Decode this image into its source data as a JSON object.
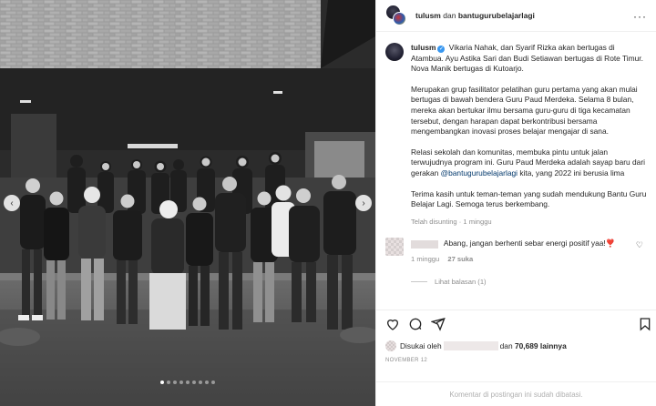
{
  "header": {
    "username": "tulusm",
    "connector": "dan",
    "collaborator": "bantugurubelajarlagi",
    "more_icon": "more-horizontal-icon"
  },
  "caption": {
    "username": "tulusm",
    "verified_icon": "verified-badge-icon",
    "paragraphs": [
      "Vikaria Nahak, dan Syarif Rizka akan bertugas di Atambua. Ayu Astika Sari dan Budi Setiawan bertugas di Rote Timur. Nova Manik bertugas di Kutoarjo.",
      "Merupakan grup fasilitator pelatihan guru pertama yang akan mulai bertugas di bawah bendera Guru Paud Merdeka. Selama 8 bulan, mereka akan bertukar ilmu bersama guru-guru di tiga kecamatan tersebut, dengan harapan dapat berkontribusi bersama mengembangkan inovasi proses belajar mengajar di sana."
    ],
    "p3_before": "Relasi sekolah dan komunitas, membuka pintu untuk jalan terwujudnya program ini. Guru Paud Merdeka adalah sayap baru dari gerakan ",
    "p3_link": "@bantugurubelajarlagi",
    "p3_after": " kita, yang 2022 ini berusia lima",
    "p4": "Terima kasih untuk teman-teman yang sudah mendukung Bantu Guru Belajar Lagi. Semoga terus berkembang.",
    "meta": "Telah disunting · 1 minggu"
  },
  "comment": {
    "text": "Abang, jangan berhenti sebar energi positif yaa!❣️",
    "time": "1 minggu",
    "likes": "27 suka",
    "replies_label": "Lihat balasan (1)",
    "heart_icon": "heart-outline-icon"
  },
  "actions": {
    "like_icon": "heart-icon",
    "comment_icon": "comment-icon",
    "share_icon": "send-icon",
    "save_icon": "bookmark-icon"
  },
  "likes": {
    "prefix": "Disukai oleh",
    "connector": "dan",
    "count": "70,689 lainnya"
  },
  "date": "NOVEMBER 12",
  "footer": "Komentar di postingan ini sudah dibatasi.",
  "carousel": {
    "total": 9,
    "active": 0
  }
}
